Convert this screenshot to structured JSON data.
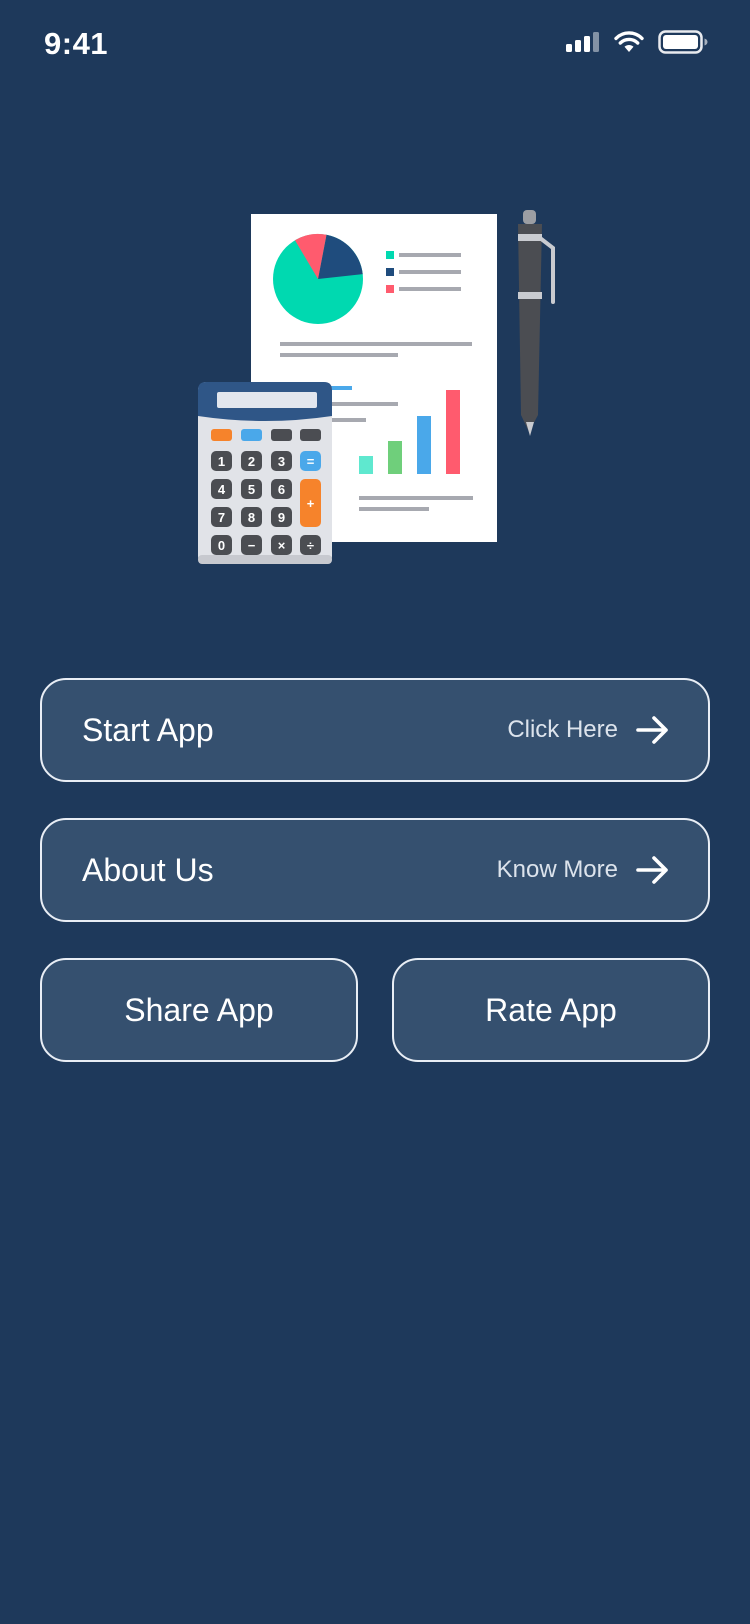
{
  "status_bar": {
    "time": "9:41",
    "icons": [
      "cellular-signal-icon",
      "wifi-icon",
      "battery-icon"
    ]
  },
  "illustration": {
    "name": "finance report with calculator and pen",
    "calculator_keys": [
      "1",
      "2",
      "3",
      "=",
      "4",
      "5",
      "6",
      "+",
      "7",
      "8",
      "9",
      "0",
      "−",
      "×",
      "÷"
    ]
  },
  "menu": {
    "start": {
      "label": "Start App",
      "hint": "Click Here",
      "icon": "arrow-right-icon"
    },
    "about": {
      "label": "About Us",
      "hint": "Know More",
      "icon": "arrow-right-icon"
    },
    "share": {
      "label": "Share App"
    },
    "rate": {
      "label": "Rate App"
    }
  },
  "colors": {
    "background": "#1e395b",
    "button_fill": "#35506f",
    "button_border": "#e9eef5",
    "pie_green": "#00d9b0",
    "pie_navy": "#1f4c7d",
    "pie_red": "#ff5b6e",
    "bar_blue": "#4aa8ea",
    "bar_green": "#6fcf7b",
    "calc_orange": "#f6832b"
  }
}
